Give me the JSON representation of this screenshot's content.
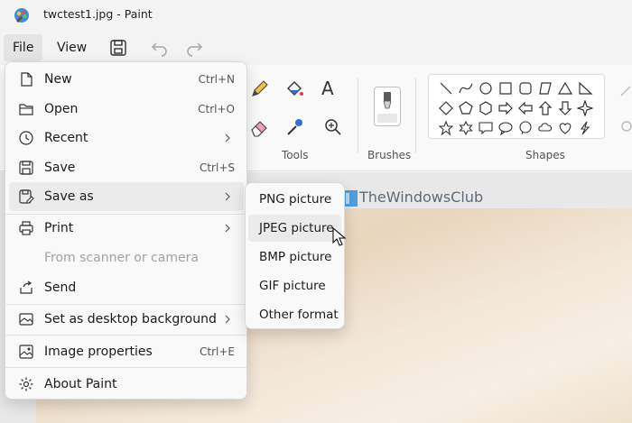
{
  "window": {
    "title": "twctest1.jpg - Paint"
  },
  "menubar": {
    "file": "File",
    "view": "View"
  },
  "ribbon": {
    "tools_label": "Tools",
    "brushes_label": "Brushes",
    "shapes_label": "Shapes",
    "text_tool": "A"
  },
  "watermark": {
    "text": "TheWindowsClub"
  },
  "file_menu": {
    "items": [
      {
        "label": "New",
        "shortcut": "Ctrl+N"
      },
      {
        "label": "Open",
        "shortcut": "Ctrl+O"
      },
      {
        "label": "Recent"
      },
      {
        "label": "Save",
        "shortcut": "Ctrl+S"
      },
      {
        "label": "Save as"
      },
      {
        "label": "Print"
      },
      {
        "label": "From scanner or camera"
      },
      {
        "label": "Send"
      },
      {
        "label": "Set as desktop background"
      },
      {
        "label": "Image properties",
        "shortcut": "Ctrl+E"
      },
      {
        "label": "About Paint"
      }
    ]
  },
  "save_as_menu": {
    "items": [
      "PNG picture",
      "JPEG picture",
      "BMP picture",
      "GIF picture",
      "Other format"
    ]
  },
  "colors": {
    "accent": "#0067c0",
    "hover": "#ebebeb",
    "disabled_text": "#a3a3a3"
  }
}
